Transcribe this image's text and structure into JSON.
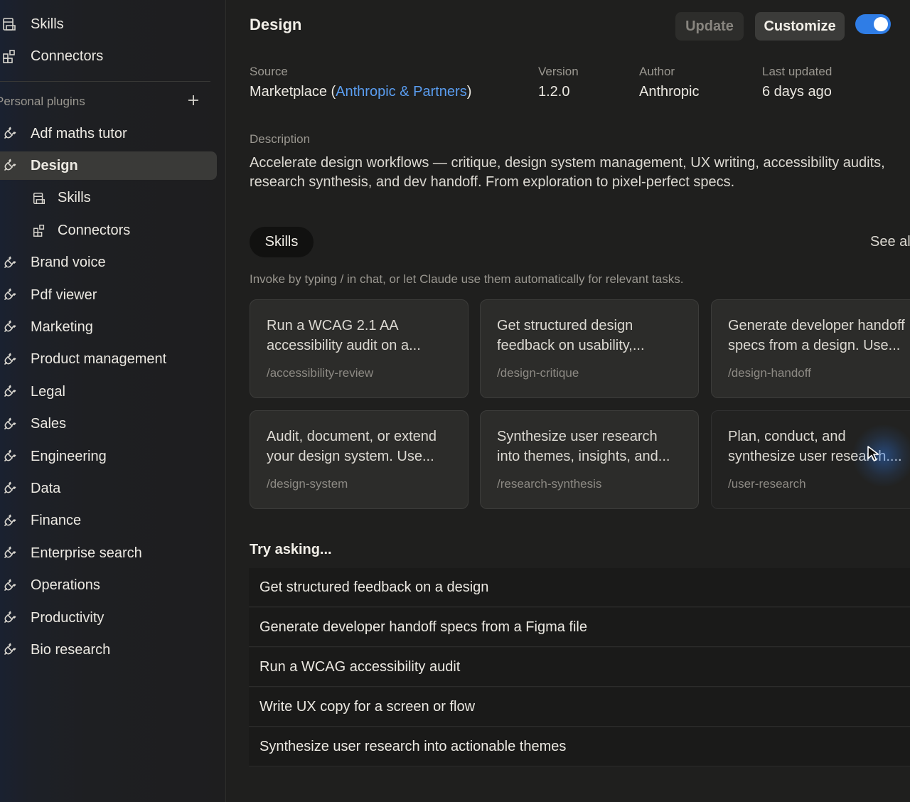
{
  "sidebar": {
    "top_items": [
      {
        "label": "Skills",
        "icon": "skills-icon"
      },
      {
        "label": "Connectors",
        "icon": "connectors-icon"
      }
    ],
    "section_title": "Personal plugins",
    "plugins": [
      {
        "label": "Adf maths tutor",
        "icon": "plug-icon"
      },
      {
        "label": "Design",
        "icon": "plug-icon",
        "active": true
      },
      {
        "label": "Skills",
        "icon": "skills-icon",
        "sub": true
      },
      {
        "label": "Connectors",
        "icon": "connectors-icon",
        "sub": true
      },
      {
        "label": "Brand voice",
        "icon": "plug-icon"
      },
      {
        "label": "Pdf viewer",
        "icon": "plug-icon"
      },
      {
        "label": "Marketing",
        "icon": "plug-icon"
      },
      {
        "label": "Product management",
        "icon": "plug-icon"
      },
      {
        "label": "Legal",
        "icon": "plug-icon"
      },
      {
        "label": "Sales",
        "icon": "plug-icon"
      },
      {
        "label": "Engineering",
        "icon": "plug-icon"
      },
      {
        "label": "Data",
        "icon": "plug-icon"
      },
      {
        "label": "Finance",
        "icon": "plug-icon"
      },
      {
        "label": "Enterprise search",
        "icon": "plug-icon"
      },
      {
        "label": "Operations",
        "icon": "plug-icon"
      },
      {
        "label": "Productivity",
        "icon": "plug-icon"
      },
      {
        "label": "Bio research",
        "icon": "plug-icon"
      }
    ]
  },
  "header": {
    "title": "Design",
    "update_label": "Update",
    "customize_label": "Customize",
    "enabled": true
  },
  "meta": {
    "source_label": "Source",
    "source_prefix": "Marketplace (",
    "source_link": "Anthropic & Partners",
    "source_suffix": ")",
    "version_label": "Version",
    "version_value": "1.2.0",
    "author_label": "Author",
    "author_value": "Anthropic",
    "updated_label": "Last updated",
    "updated_value": "6 days ago"
  },
  "description": {
    "label": "Description",
    "text": "Accelerate design workflows — critique, design system management, UX writing, accessibility audits, research synthesis, and dev handoff. From exploration to pixel-perfect specs."
  },
  "skills": {
    "tab_label": "Skills",
    "see_all": "See all",
    "hint": "Invoke by typing / in chat, or let Claude use them automatically for relevant tasks.",
    "cards": [
      {
        "title": "Run a WCAG 2.1 AA accessibility audit on a...",
        "command": "/accessibility-review"
      },
      {
        "title": "Get structured design feedback on usability,...",
        "command": "/design-critique"
      },
      {
        "title": "Generate developer handoff specs from a design. Use...",
        "command": "/design-handoff"
      },
      {
        "title": "Audit, document, or extend your design system. Use...",
        "command": "/design-system"
      },
      {
        "title": "Synthesize user research into themes, insights, and...",
        "command": "/research-synthesis"
      },
      {
        "title": "Plan, conduct, and synthesize user research....",
        "command": "/user-research"
      }
    ]
  },
  "try_asking": {
    "title": "Try asking...",
    "items": [
      "Get structured feedback on a design",
      "Generate developer handoff specs from a Figma file",
      "Run a WCAG accessibility audit",
      "Write UX copy for a screen or flow",
      "Synthesize user research into actionable themes"
    ]
  }
}
